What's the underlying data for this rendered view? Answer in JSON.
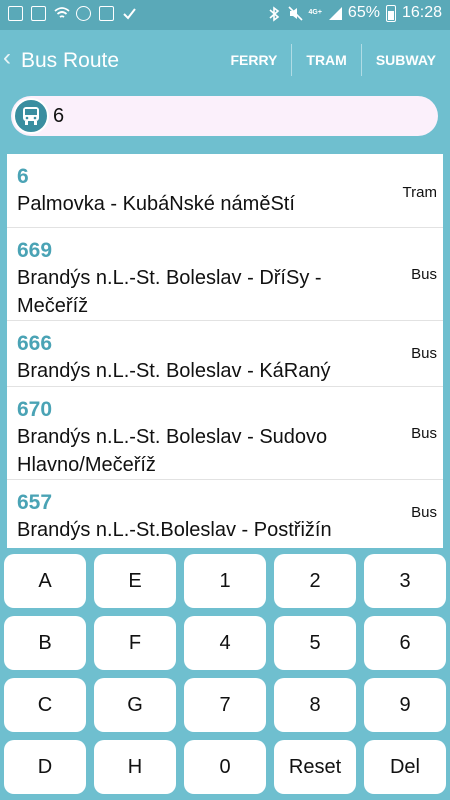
{
  "status": {
    "battery": "65%",
    "time": "16:28",
    "network": "4G+",
    "icons": [
      "line-icon",
      "image-icon",
      "wifi-icon",
      "chrome-icon",
      "mail-icon",
      "checkmark-icon"
    ]
  },
  "header": {
    "back_icon": "chevron-left-icon",
    "title": "Bus Route",
    "tabs": [
      "FERRY",
      "TRAM",
      "SUBWAY"
    ]
  },
  "search": {
    "icon": "bus-icon",
    "value": "6"
  },
  "routes": [
    {
      "number": "6",
      "name": "Palmovka - KubáNské náměStí",
      "type": "Tram"
    },
    {
      "number": "669",
      "name": "Brandýs n.L.-St. Boleslav - DříSy - Mečeříž",
      "type": "Bus"
    },
    {
      "number": "666",
      "name": "Brandýs n.L.-St. Boleslav - KáRaný",
      "type": "Bus"
    },
    {
      "number": "670",
      "name": "Brandýs n.L.-St. Boleslav - Sudovo Hlavno/Mečeříž",
      "type": "Bus"
    },
    {
      "number": "657",
      "name": "Brandýs n.L.-St.Boleslav - Postřižín",
      "type": "Bus"
    }
  ],
  "keypad": {
    "keys": [
      [
        "A",
        "E",
        "1",
        "2",
        "3"
      ],
      [
        "B",
        "F",
        "4",
        "5",
        "6"
      ],
      [
        "C",
        "G",
        "7",
        "8",
        "9"
      ],
      [
        "D",
        "H",
        "0",
        "Reset",
        "Del"
      ]
    ]
  },
  "colors": {
    "header_bg": "#6fbfcf",
    "status_bg": "#5aa9b8",
    "route_number": "#4aa3b5",
    "search_bg": "#fbf0fb",
    "bus_badge": "#3a8ea0"
  }
}
